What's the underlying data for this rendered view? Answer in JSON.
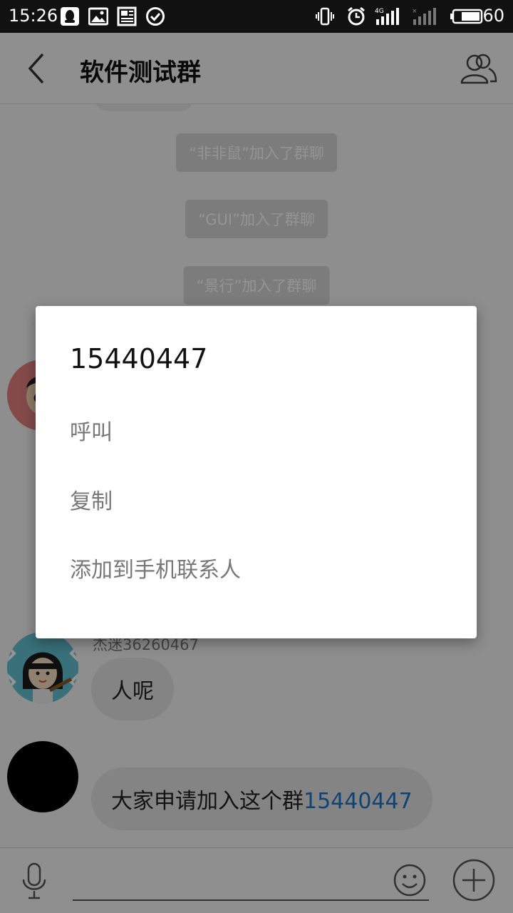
{
  "status_bar": {
    "time": "15:26",
    "battery": "60",
    "icons_left": [
      "qq-icon",
      "image-icon",
      "news-icon",
      "check-circle-icon"
    ],
    "icons_right": [
      "vibrate-icon",
      "alarm-icon",
      "signal-4g-icon",
      "signal-weak-icon",
      "battery-icon"
    ]
  },
  "header": {
    "title": "软件测试群",
    "back_icon": "chevron-left-icon",
    "members_icon": "group-icon"
  },
  "chat": {
    "system_messages": [
      "“非非鼠”加入了群聊",
      "“GUI”加入了群聊",
      "“景行”加入了群聊"
    ],
    "messages": [
      {
        "sender": "杰迷36260467",
        "text": "人呢"
      },
      {
        "text_prefix": "大家申请加入这个群",
        "link": "15440447"
      }
    ]
  },
  "dialog": {
    "title": "15440447",
    "options": [
      "呼叫",
      "复制",
      "添加到手机联系人"
    ]
  },
  "input_bar": {
    "mic_icon": "microphone-icon",
    "emoji_icon": "smiley-icon",
    "plus_icon": "plus-circle-icon"
  },
  "colors": {
    "link": "#1a74c8",
    "status_bar": "#111111",
    "bubble": "#e4e4e4",
    "overlay": "rgba(0,0,0,0.42)"
  }
}
